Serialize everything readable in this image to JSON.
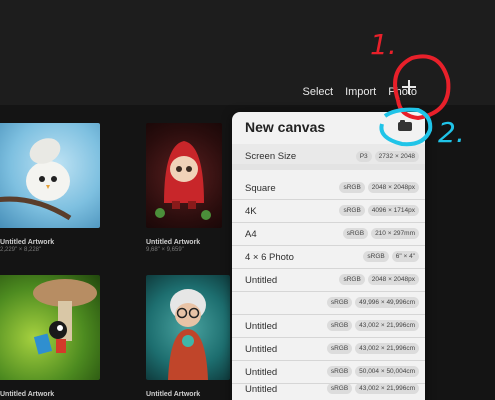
{
  "top_actions": [
    "Select",
    "Import",
    "Photo"
  ],
  "gallery": [
    {
      "title": "Untitled Artwork",
      "size": "2,229\" × 8,228\""
    },
    {
      "title": "Untitled Artwork",
      "size": "9,68\" × 9,659\""
    },
    {
      "title": "Untitled Artwork",
      "size": ""
    },
    {
      "title": "Untitled Artwork",
      "size": ""
    }
  ],
  "panel": {
    "title": "New canvas",
    "screen_size": {
      "name": "Screen Size",
      "tags": [
        "P3",
        "2732 × 2048"
      ]
    },
    "rows": [
      {
        "name": "Square",
        "tags": [
          "sRGB",
          "2048 × 2048px"
        ]
      },
      {
        "name": "4K",
        "tags": [
          "sRGB",
          "4096 × 1714px"
        ]
      },
      {
        "name": "A4",
        "tags": [
          "sRGB",
          "210 × 297mm"
        ]
      },
      {
        "name": "4 × 6 Photo",
        "tags": [
          "sRGB",
          "6\" × 4\""
        ]
      },
      {
        "name": "Untitled",
        "tags": [
          "sRGB",
          "2048 × 2048px"
        ]
      },
      {
        "name": "",
        "tags": [
          "sRGB",
          "49,996 × 49,996cm"
        ]
      },
      {
        "name": "Untitled",
        "tags": [
          "sRGB",
          "43,002 × 21,996cm"
        ]
      },
      {
        "name": "Untitled",
        "tags": [
          "sRGB",
          "43,002 × 21,996cm"
        ]
      },
      {
        "name": "Untitled",
        "tags": [
          "sRGB",
          "50,004 × 50,004cm"
        ]
      },
      {
        "name": "Untitled",
        "tags": [
          "sRGB",
          "43,002 × 21,996cm"
        ]
      }
    ]
  },
  "annotations": {
    "one": "1.",
    "two": "2."
  },
  "colors": {
    "annotation_red": "#e8202a",
    "annotation_cyan": "#20c4e8"
  }
}
